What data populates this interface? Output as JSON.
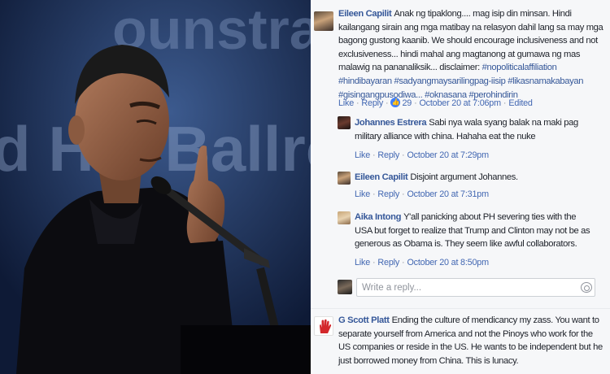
{
  "photo": {
    "alt_subject": "speaker-at-podium",
    "banner_text": [
      "ounstrauug",
      "d Hal Ballro"
    ]
  },
  "comments": [
    {
      "author": "Eileen Capilit",
      "body": "Anak ng tipaklong.... mag isip din minsan. Hindi kailangang sirain ang mga matibay na relasyon dahil lang sa may mga bagong gustong kaanib. We should encourage inclusiveness and not exclusiveness... hindi mahal ang magtanong at gumawa ng mas malawig na pananaliksik... disclaimer:",
      "hashtags": "#nopoliticalaffiliation #hindibayaran #sadyangmaysarilingpag-iisip #likasnamakabayan #gisingangpusodiwa... #oknasana #perohindirin",
      "like": "Like",
      "reply": "Reply",
      "like_count": "29",
      "time": "October 20 at 7:06pm",
      "edited": "Edited"
    },
    {
      "author": "Johannes Estrera",
      "body": "Sabi nya wala syang balak na maki pag military alliance with china. Hahaha eat the nuke",
      "like": "Like",
      "reply": "Reply",
      "time": "October 20 at 7:29pm"
    },
    {
      "author": "Eileen Capilit",
      "body": "Disjoint argument Johannes.",
      "like": "Like",
      "reply": "Reply",
      "time": "October 20 at 7:31pm"
    },
    {
      "author": "Aika Intong",
      "body": "Y'all panicking about PH severing ties with the USA but forget to realize that Trump and Clinton may not be as generous as Obama is. They seem like awful collaborators.",
      "like": "Like",
      "reply": "Reply",
      "time": "October 20 at 8:50pm"
    },
    {
      "author": "G Scott Platt",
      "body": "Ending the culture of mendicancy my zass. You want to separate yourself from America and not the Pinoys who work for the US companies or reside in the US. He wants to be independent but he just borrowed money from China. This is lunacy."
    }
  ],
  "reply_box": {
    "placeholder": "Write a reply..."
  },
  "colors": {
    "link": "#365899",
    "panel_bg": "#f6f7f9",
    "meta": "#90949c"
  }
}
